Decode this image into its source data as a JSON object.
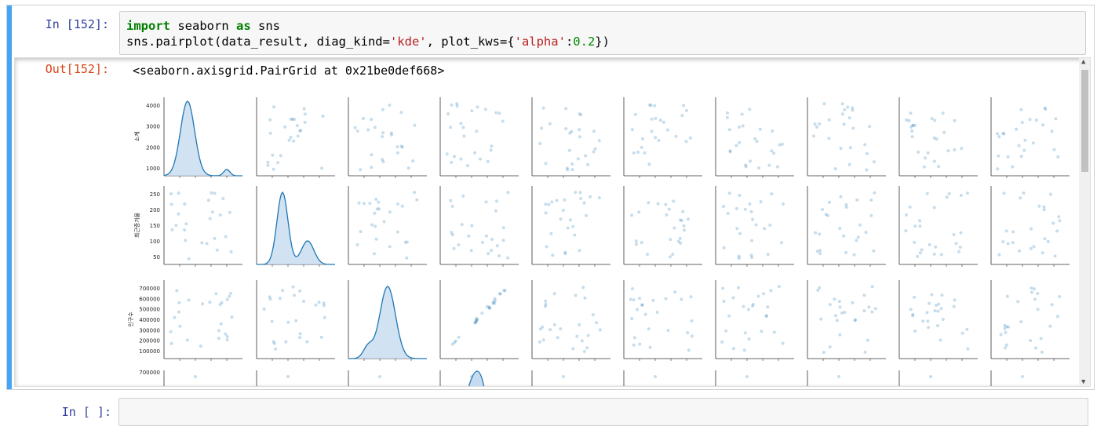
{
  "cell1": {
    "in_prompt": "In [152]:",
    "code_line1": {
      "kw_import": "import",
      "mod": " seaborn ",
      "kw_as": "as",
      "alias": " sns"
    },
    "code_line2": {
      "p1": "sns.pairplot(data_result, diag_kind=",
      "s1": "'kde'",
      "p2": ", plot_kws={",
      "s2": "'alpha'",
      "p3": ":",
      "n1": "0.2",
      "p4": "})"
    },
    "out_prompt": "Out[152]:",
    "out_text": "<seaborn.axisgrid.PairGrid at 0x21be0def668>"
  },
  "cell2": {
    "in_prompt": "In [ ]:"
  },
  "chart_data": {
    "type": "scatter",
    "description_kind": "pairplot",
    "diag_kind": "kde",
    "alpha": 0.2,
    "point_color": "#1f77b4",
    "fill_color": "#c6dbef",
    "rows": [
      {
        "ylabel": "소계",
        "yticks": [
          "1000",
          "2000",
          "3000",
          "4000"
        ]
      },
      {
        "ylabel": "최근증가율",
        "yticks": [
          "50",
          "100",
          "150",
          "200",
          "250"
        ]
      },
      {
        "ylabel": "인구수",
        "yticks": [
          "100000",
          "200000",
          "300000",
          "400000",
          "500000",
          "600000",
          "700000"
        ]
      },
      {
        "ylabel": "",
        "yticks": [
          "700000"
        ]
      }
    ]
  }
}
